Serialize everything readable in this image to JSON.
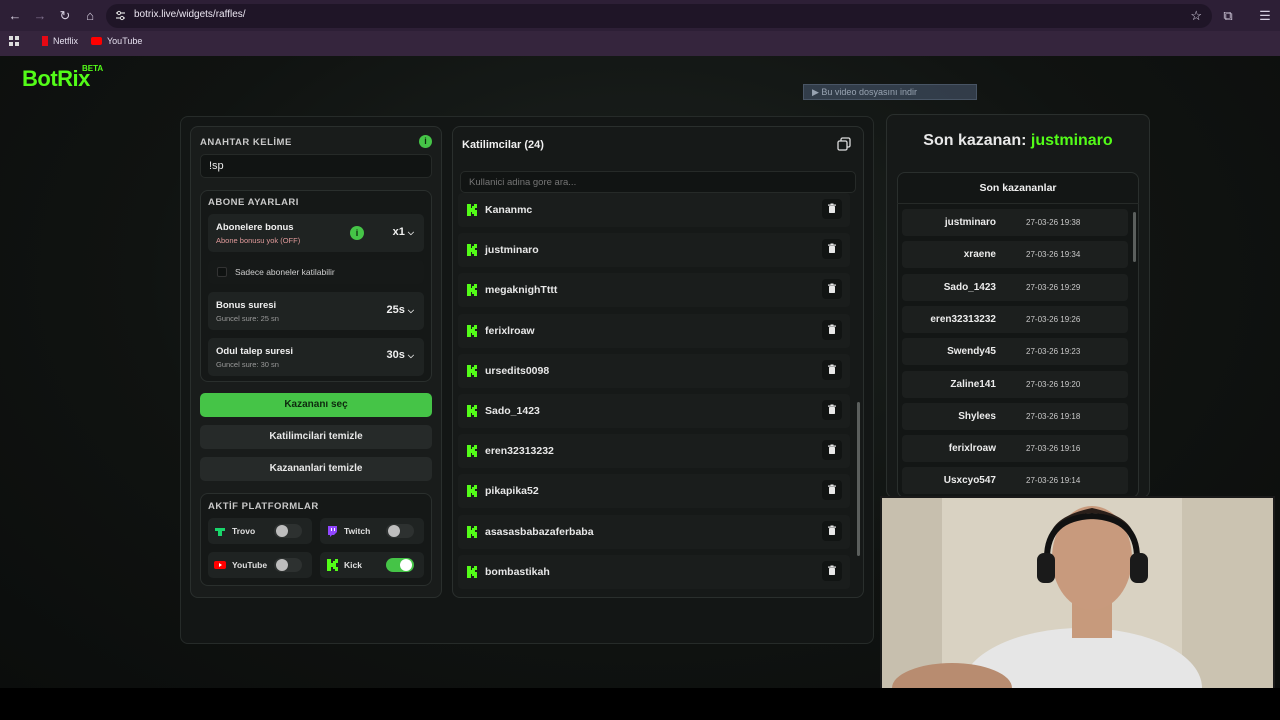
{
  "browser": {
    "url": "botrix.live/widgets/raffles/",
    "bookmarks": [
      {
        "label": "Netflix",
        "icon": "netflix-icon",
        "color": "#e50914"
      },
      {
        "label": "YouTube",
        "icon": "youtube-icon",
        "color": "#ff0000"
      }
    ]
  },
  "brand": {
    "logo": "BotRix",
    "badge": "BETA",
    "accent": "#53fc18"
  },
  "download_banner": "▶ Bu video dosyasını indir",
  "left_panel": {
    "keyword_label": "ANAHTAR KELİME",
    "keyword_value": "!sp",
    "subscriber_settings_label": "ABONE AYARLARI",
    "sub_bonus": {
      "title": "Abonelere bonus",
      "subtitle": "Abone bonusu yok (OFF)",
      "value": "x1"
    },
    "subs_only": {
      "label": "Sadece aboneler katilabilir",
      "checked": false
    },
    "bonus_time": {
      "title": "Bonus suresi",
      "subtitle": "Guncel sure: 25 sn",
      "value": "25s"
    },
    "claim_time": {
      "title": "Odul talep suresi",
      "subtitle": "Guncel sure: 30 sn",
      "value": "30s"
    },
    "btn_pick": "Kazananı seç",
    "btn_clear_participants": "Katilimcilari temizle",
    "btn_clear_winners": "Kazananlari temizle",
    "platforms_label": "AKTİF PLATFORMLAR",
    "platforms": [
      {
        "name": "Trovo",
        "icon": "trovo-icon",
        "color": "#19d66b",
        "enabled": false
      },
      {
        "name": "Twitch",
        "icon": "twitch-icon",
        "color": "#9146ff",
        "enabled": false
      },
      {
        "name": "YouTube",
        "icon": "youtube-icon",
        "color": "#ff0000",
        "enabled": false
      },
      {
        "name": "Kick",
        "icon": "kick-icon",
        "color": "#53fc18",
        "enabled": true
      }
    ]
  },
  "participants": {
    "title": "Katilimcilar (24)",
    "search_placeholder": "Kullanici adina gore ara...",
    "items": [
      "Kananmc",
      "justminaro",
      "megaknighTttt",
      "ferixlroaw",
      "ursedits0098",
      "Sado_1423",
      "eren32313232",
      "pikapika52",
      "asasasbabazaferbaba",
      "bombastikah"
    ]
  },
  "winners": {
    "title_prefix": "Son kazanan:",
    "title_name": "justminaro",
    "list_title": "Son kazananlar",
    "items": [
      {
        "name": "justminaro",
        "date": "27-03-26 19:38"
      },
      {
        "name": "xraene",
        "date": "27-03-26 19:34"
      },
      {
        "name": "Sado_1423",
        "date": "27-03-26 19:29"
      },
      {
        "name": "eren32313232",
        "date": "27-03-26 19:26"
      },
      {
        "name": "Swendy45",
        "date": "27-03-26 19:23"
      },
      {
        "name": "Zaline141",
        "date": "27-03-26 19:20"
      },
      {
        "name": "Shylees",
        "date": "27-03-26 19:18"
      },
      {
        "name": "ferixlroaw",
        "date": "27-03-26 19:16"
      },
      {
        "name": "Usxcyo547",
        "date": "27-03-26 19:14"
      }
    ]
  }
}
